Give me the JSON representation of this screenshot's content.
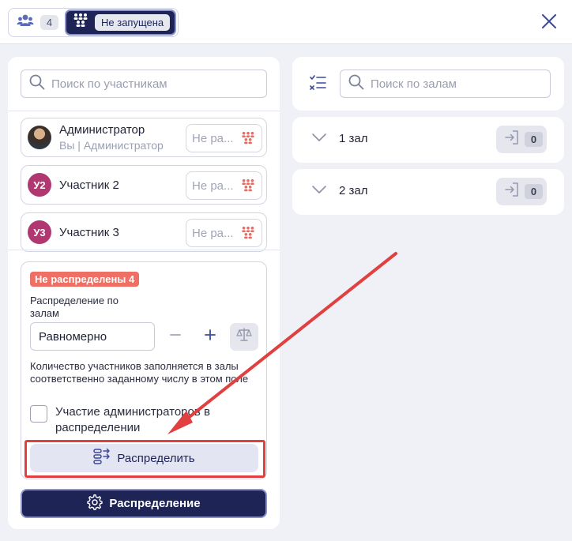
{
  "header": {
    "participants_count": "4",
    "status_label": "Не запущена"
  },
  "participants_panel": {
    "search_placeholder": "Поиск по участникам",
    "participants": [
      {
        "name": "Администратор",
        "subtitle": "Вы | Администратор",
        "avatar": "photo",
        "room_value": "Не ра..."
      },
      {
        "name": "Участник 2",
        "initials": "У2",
        "avatar_color": "#b0376f",
        "room_value": "Не ра..."
      },
      {
        "name": "Участник 3",
        "initials": "У3",
        "avatar_color": "#b0376f",
        "room_value": "Не ра..."
      }
    ],
    "distribution": {
      "unassigned_badge": "Не распределены 4",
      "mode_label": "Распределение по залам",
      "mode_value": "Равномерно",
      "hint": "Количество участников заполняется в залы соответственно заданному числу в этом поле",
      "admins_checkbox_label": "Участие администраторов в распределении",
      "admins_checkbox_checked": false,
      "distribute_button": "Распределить"
    },
    "settings_button": "Распределение"
  },
  "rooms_panel": {
    "search_placeholder": "Поиск по залам",
    "rooms": [
      {
        "name": "1 зал",
        "count": "0"
      },
      {
        "name": "2 зал",
        "count": "0"
      }
    ]
  },
  "colors": {
    "accent_dark": "#1f2456",
    "badge_red": "#ee6f63",
    "annotation_red": "#e04040",
    "icon_coral": "#ea6b62"
  }
}
